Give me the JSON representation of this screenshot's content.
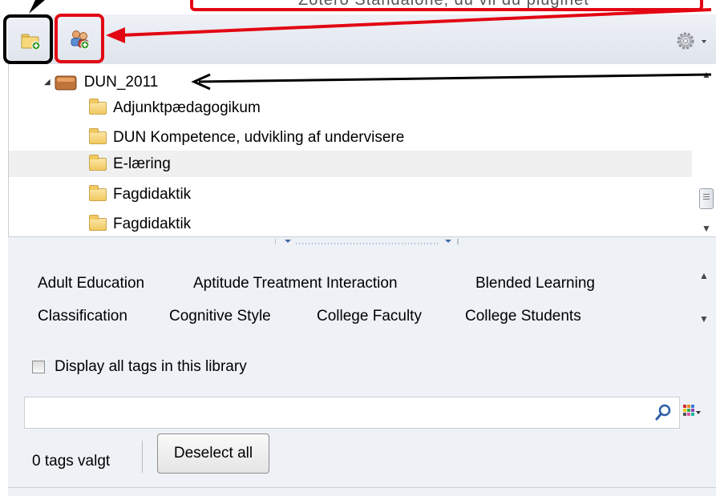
{
  "top_partial_text": "Zotero Standalone, du vil du pluginet",
  "tree": {
    "root_label": "DUN_2011",
    "items": [
      {
        "label": "Adjunktpædagogikum"
      },
      {
        "label": "DUN Kompetence, udvikling af undervisere"
      },
      {
        "label": "E-læring"
      },
      {
        "label": "Fagdidaktik"
      },
      {
        "label": "Fagdidaktik"
      }
    ],
    "selected_index": 2
  },
  "tags": {
    "row1": [
      "Adult Education",
      "Aptitude Treatment Interaction",
      "Blended Learning"
    ],
    "row2": [
      "Classification",
      "Cognitive Style",
      "College Faculty",
      "College Students"
    ]
  },
  "display_all_label": "Display all tags in this library",
  "display_all_checked": false,
  "search": {
    "value": "",
    "placeholder": ""
  },
  "tags_selected_label": "0 tags valgt",
  "deselect_label": "Deselect all",
  "icons": {
    "new_collection": "folder-add-icon",
    "new_group": "group-add-icon",
    "actions": "gear-icon",
    "search": "magnifier-icon",
    "tag_color": "color-grid-icon"
  },
  "annotation_colors": {
    "red": "#e30613",
    "black": "#000000"
  }
}
